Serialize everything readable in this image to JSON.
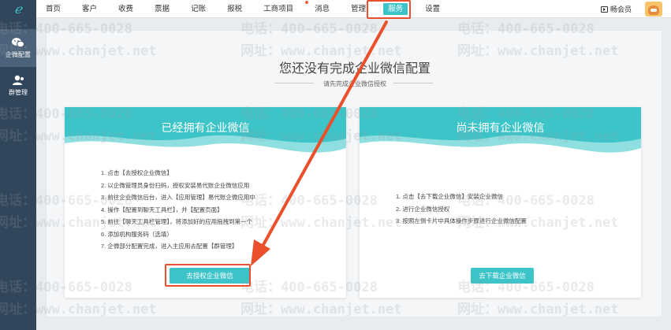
{
  "nav": {
    "items": [
      "首页",
      "客户",
      "收费",
      "票据",
      "记账",
      "报税",
      "工商项目",
      "消息",
      "管理",
      "服务",
      "设置"
    ],
    "active_index": 9,
    "member_label": "畅会员"
  },
  "sidebar": {
    "items": [
      {
        "label": "企微配置",
        "icon": "wechat-work-icon",
        "active": true
      },
      {
        "label": "群管理",
        "icon": "group-user-icon",
        "active": false
      }
    ]
  },
  "main": {
    "title": "您还没有完成企业微信配置",
    "subtitle": "请先完成企业微信授权"
  },
  "cards": [
    {
      "title": "已经拥有企业微信",
      "steps": [
        "1. 点击【去授权企业微信】",
        "2. 以企微管理员身份扫码，授权安装易代账企业微信应用",
        "3. 前往企业微信后台，进入【应用管理】易代账企微应用中",
        "4. 操作【配置到聊天工具栏】，并【配置页面】",
        "5. 前往【聊天工具栏管理】，将添加好的应用拖拽到第一个",
        "6. 添加机构服务码（选填）",
        "7. 企微部分配置完成，进入主应用去配置【群管理】"
      ],
      "button": "去授权企业微信"
    },
    {
      "title": "尚未拥有企业微信",
      "steps": [
        "1. 点击【去下载企业微信】安装企业微信",
        "2. 进行企业微信授权",
        "3. 按照左侧卡片中具体操作步骤进行企业微信配置"
      ],
      "button": "去下载企业微信"
    }
  ],
  "watermark": {
    "phone": "电话：400-665-0028",
    "site": "网址：www.chanjet.net"
  },
  "colors": {
    "accent": "#3cc4c8",
    "sidebar": "#32465b",
    "annotation": "#e9502b"
  }
}
